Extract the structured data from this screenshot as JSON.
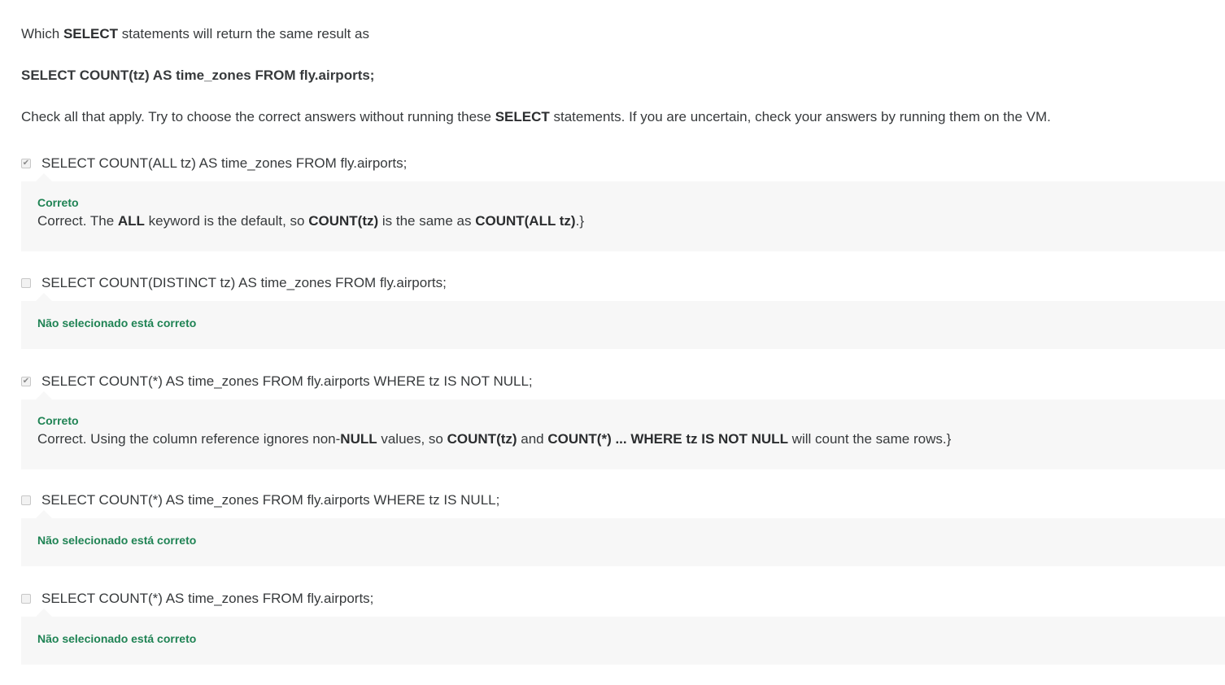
{
  "question": {
    "intro_prefix": "Which ",
    "intro_keyword": "SELECT",
    "intro_suffix": " statements will return the same result as",
    "query": "SELECT COUNT(tz) AS time_zones FROM fly.airports;",
    "instructions_prefix": "Check all that apply. Try to choose the correct answers without running these ",
    "instructions_keyword": "SELECT",
    "instructions_suffix": " statements. If you are uncertain, check your answers by running them on the VM."
  },
  "options": [
    {
      "label": "SELECT COUNT(ALL tz) AS time_zones FROM fly.airports;",
      "checked": true,
      "status": "Correto",
      "explanation": {
        "t1": "Correct. The ",
        "b1": "ALL",
        "t2": " keyword is the default, so ",
        "b2": "COUNT(tz)",
        "t3": " is the same as ",
        "b3": "COUNT(ALL tz)",
        "t4": ".}"
      }
    },
    {
      "label": "SELECT COUNT(DISTINCT tz) AS time_zones FROM fly.airports;",
      "checked": false,
      "status": "Não selecionado está correto"
    },
    {
      "label": "SELECT COUNT(*) AS time_zones FROM fly.airports WHERE tz IS NOT NULL;",
      "checked": true,
      "status": "Correto",
      "explanation": {
        "t1": "Correct. Using the column reference ignores non-",
        "b1": "NULL",
        "t2": " values, so ",
        "b2": "COUNT(tz)",
        "t3": " and ",
        "b3": "COUNT(*) ... WHERE tz IS NOT NULL",
        "t4": " will count the same rows.}"
      }
    },
    {
      "label": "SELECT COUNT(*) AS time_zones FROM fly.airports WHERE tz IS NULL;",
      "checked": false,
      "status": "Não selecionado está correto"
    },
    {
      "label": "SELECT COUNT(*) AS time_zones FROM fly.airports;",
      "checked": false,
      "status": "Não selecionado está correto"
    }
  ],
  "icons": {
    "checked": "checkmark-icon"
  },
  "colors": {
    "status_green": "#1f8354",
    "feedback_bg": "#f7f7f7",
    "text": "#373a3c"
  }
}
